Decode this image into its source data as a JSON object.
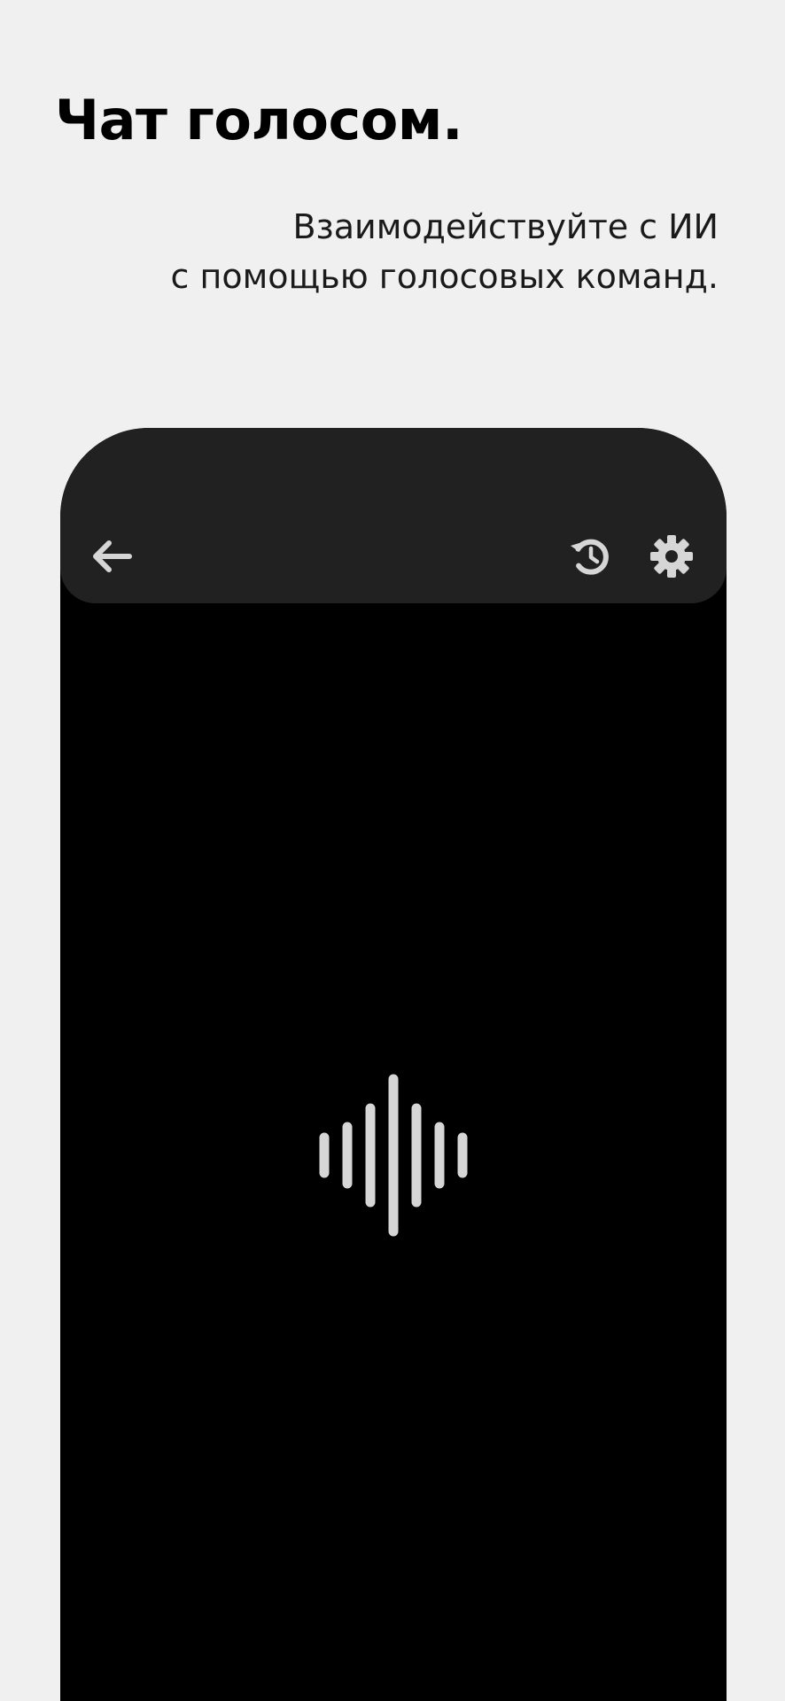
{
  "promo": {
    "title": "Чат голосом.",
    "subtitle_line1": "Взаимодействуйте с ИИ",
    "subtitle_line2": "с помощью голосовых команд."
  },
  "app_bar": {
    "back_icon": "arrow-back-icon",
    "history_icon": "history-clock-icon",
    "settings_icon": "gear-icon"
  },
  "voice_indicator": {
    "icon": "sound-wave-icon"
  },
  "colors": {
    "page_background": "#f0f0f0",
    "app_bar_background": "#212121",
    "screen_background": "#000000",
    "icon_color": "#d6d6d6"
  }
}
